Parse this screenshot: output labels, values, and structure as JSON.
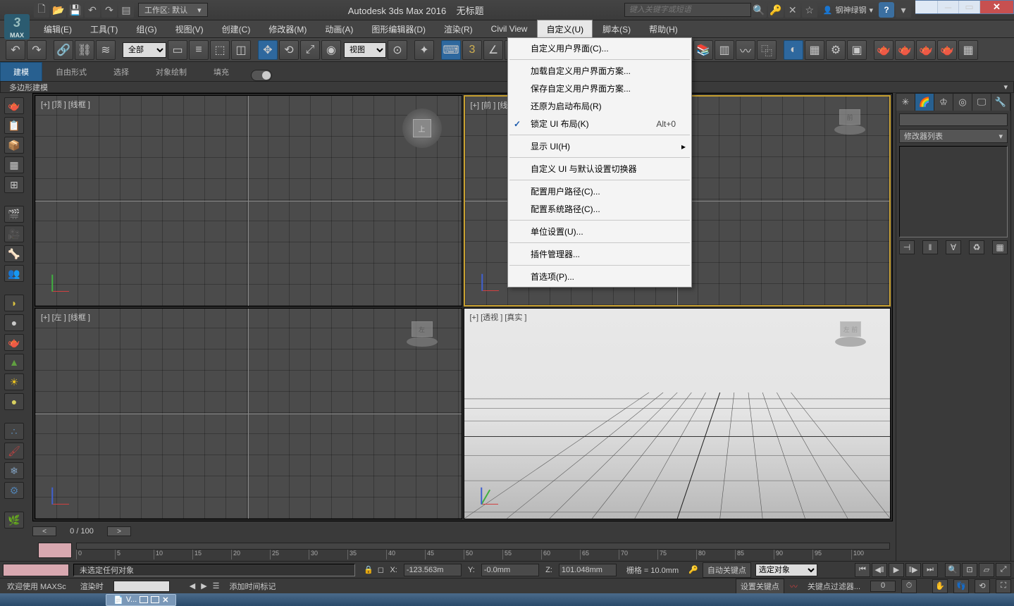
{
  "window": {
    "app_title": "Autodesk 3ds Max 2016",
    "doc_title": "无标题",
    "logo_text": "MAX"
  },
  "titlebar": {
    "workspace_label": "工作区: 默认",
    "search_placeholder": "键入关键字或短语",
    "user_name": "钢神绿钢"
  },
  "menubar": {
    "items": [
      "编辑(E)",
      "工具(T)",
      "组(G)",
      "视图(V)",
      "创建(C)",
      "修改器(M)",
      "动画(A)",
      "图形编辑器(D)",
      "渲染(R)",
      "Civil View",
      "自定义(U)",
      "脚本(S)",
      "帮助(H)"
    ],
    "open_index": 10
  },
  "dropdown": {
    "items": [
      {
        "label": "自定义用户界面(C)..."
      },
      {
        "sep": true
      },
      {
        "label": "加载自定义用户界面方案..."
      },
      {
        "label": "保存自定义用户界面方案..."
      },
      {
        "label": "还原为启动布局(R)"
      },
      {
        "label": "锁定 UI 布局(K)",
        "shortcut": "Alt+0",
        "checked": true
      },
      {
        "sep": true
      },
      {
        "label": "显示 UI(H)",
        "submenu": true
      },
      {
        "sep": true
      },
      {
        "label": "自定义 UI 与默认设置切换器"
      },
      {
        "sep": true
      },
      {
        "label": "配置用户路径(C)..."
      },
      {
        "label": "配置系统路径(C)..."
      },
      {
        "sep": true
      },
      {
        "label": "单位设置(U)..."
      },
      {
        "sep": true
      },
      {
        "label": "插件管理器..."
      },
      {
        "sep": true
      },
      {
        "label": "首选项(P)..."
      }
    ]
  },
  "toolbar": {
    "selection_filter": "全部",
    "ref_coord": "视图",
    "snap_label": "3"
  },
  "ribbon": {
    "tabs": [
      "建模",
      "自由形式",
      "选择",
      "对象绘制",
      "填充"
    ],
    "active": 0,
    "panel_label": "多边形建模"
  },
  "viewports": {
    "tl": "[+] [顶 ] [线框 ]",
    "tr": "[+] [前 ] [线框 ]",
    "bl": "[+] [左 ] [线框 ]",
    "br": "[+] [透视 ] [真实 ]",
    "cube_top": "上",
    "cube_left": "左",
    "cube_front": "前",
    "cube_persp": "左  前"
  },
  "cmdpanel": {
    "modifier_list_label": "修改器列表"
  },
  "timeline": {
    "pos": "0 / 100",
    "ticks": [
      "0",
      "5",
      "10",
      "15",
      "20",
      "25",
      "30",
      "35",
      "40",
      "45",
      "50",
      "55",
      "60",
      "65",
      "70",
      "75",
      "80",
      "85",
      "90",
      "95",
      "100"
    ]
  },
  "status": {
    "selection_msg": "未选定任何对象",
    "x": "-123.563m",
    "y": "-0.0mm",
    "z": "101.048mm",
    "grid": "栅格 = 10.0mm",
    "autokey": "自动关键点",
    "keymode": "选定对象",
    "setkey": "设置关键点",
    "keyfilter": "关键点过滤器...",
    "welcome": "欢迎使用  MAXSc",
    "render_time": "渲染时",
    "add_time_tag": "添加时间标记"
  },
  "taskbar": {
    "item": "V..."
  }
}
